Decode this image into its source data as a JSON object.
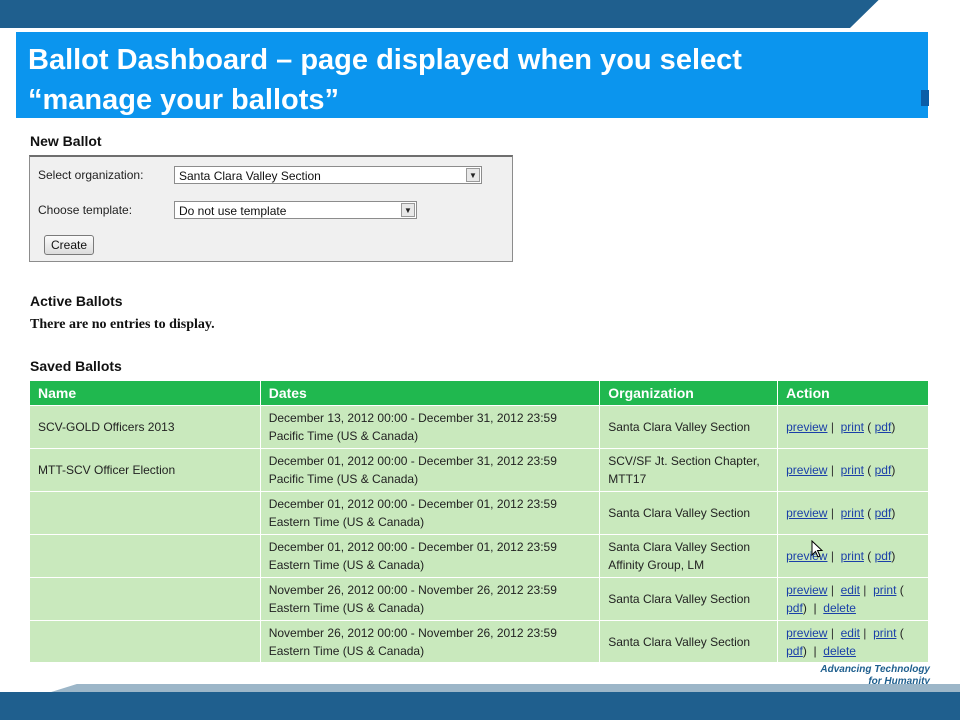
{
  "title": {
    "line1": "Ballot Dashboard – page displayed when you select",
    "line2": "“manage your ballots”"
  },
  "new_ballot": {
    "heading": "New Ballot",
    "org_label": "Select organization:",
    "org_value": "Santa Clara Valley Section",
    "template_label": "Choose template:",
    "template_value": "Do not use template",
    "create_label": "Create"
  },
  "active_ballots": {
    "heading": "Active Ballots",
    "empty_text": "There are no entries to display."
  },
  "saved_ballots": {
    "heading": "Saved Ballots",
    "columns": [
      "Name",
      "Dates",
      "Organization",
      "Action"
    ],
    "rows": [
      {
        "name": "SCV-GOLD Officers 2013",
        "dates1": "December 13, 2012 00:00 -  December 31, 2012 23:59",
        "dates2": "Pacific Time (US & Canada)",
        "org1": "Santa Clara Valley Section",
        "org2": ""
      },
      {
        "name": "MTT-SCV Officer Election",
        "dates1": "December 01, 2012 00:00 -  December 31, 2012 23:59",
        "dates2": "Pacific Time (US & Canada)",
        "org1": "SCV/SF Jt. Section Chapter,",
        "org2": "MTT17"
      },
      {
        "name": "",
        "dates1": "December 01, 2012 00:00 -  December 01, 2012 23:59",
        "dates2": "Eastern Time (US & Canada)",
        "org1": "Santa Clara Valley Section",
        "org2": ""
      },
      {
        "name": "",
        "dates1": "December 01, 2012 00:00 -  December 01, 2012 23:59",
        "dates2": "Eastern Time (US & Canada)",
        "org1": "Santa Clara Valley Section",
        "org2": "Affinity Group, LM"
      },
      {
        "name": "",
        "dates1": "November 26, 2012 00:00 -  November 26, 2012 23:59",
        "dates2": "Eastern Time (US & Canada)",
        "org1": "Santa Clara Valley Section",
        "org2": ""
      },
      {
        "name": "",
        "dates1": "November 26, 2012 00:00 -  November 26, 2012 23:59",
        "dates2": "Eastern Time (US & Canada)",
        "org1": "Santa Clara Valley Section",
        "org2": ""
      }
    ],
    "actions": {
      "preview": "preview",
      "print": "print",
      "pdf": "pdf",
      "edit": "edit",
      "delete": "delete"
    }
  },
  "footer": {
    "tagline1": "Advancing Technology",
    "tagline2": "for Humanity"
  },
  "colors": {
    "title_bg": "#0b95ee",
    "header_green": "#20b84f",
    "row_green": "#c9e9bd",
    "band_blue": "#1f5f8e",
    "link_blue": "#1a3fa8"
  }
}
